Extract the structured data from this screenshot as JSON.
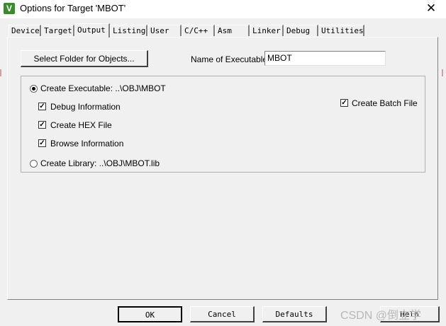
{
  "window": {
    "title": "Options for Target 'MBOT'",
    "icon": "V",
    "close_glyph": "✕"
  },
  "tabs": [
    {
      "label": "Device"
    },
    {
      "label": "Target"
    },
    {
      "label": "Output",
      "active": true
    },
    {
      "label": "Listing"
    },
    {
      "label": "User"
    },
    {
      "label": "C/C++"
    },
    {
      "label": "Asm"
    },
    {
      "label": "Linker"
    },
    {
      "label": "Debug"
    },
    {
      "label": "Utilities"
    }
  ],
  "output": {
    "select_folder_label": "Select Folder for Objects...",
    "name_of_executable_label": "Name of Executable:",
    "name_of_executable_value": "MBOT",
    "create_executable_label": "Create Executable:  ..\\OBJ\\MBOT",
    "debug_information_label": "Debug Information",
    "create_hex_label": "Create HEX File",
    "browse_information_label": "Browse Information",
    "create_batch_label": "Create Batch File",
    "create_library_label": "Create Library:  ..\\OBJ\\MBOT.lib"
  },
  "states": {
    "create_executable": true,
    "create_library": false,
    "debug_information": true,
    "create_hex": true,
    "browse_information": true,
    "create_batch": true
  },
  "buttons": {
    "ok": "OK",
    "cancel": "Cancel",
    "defaults": "Defaults",
    "help": "Help"
  },
  "watermark": "CSDN @倒立学"
}
